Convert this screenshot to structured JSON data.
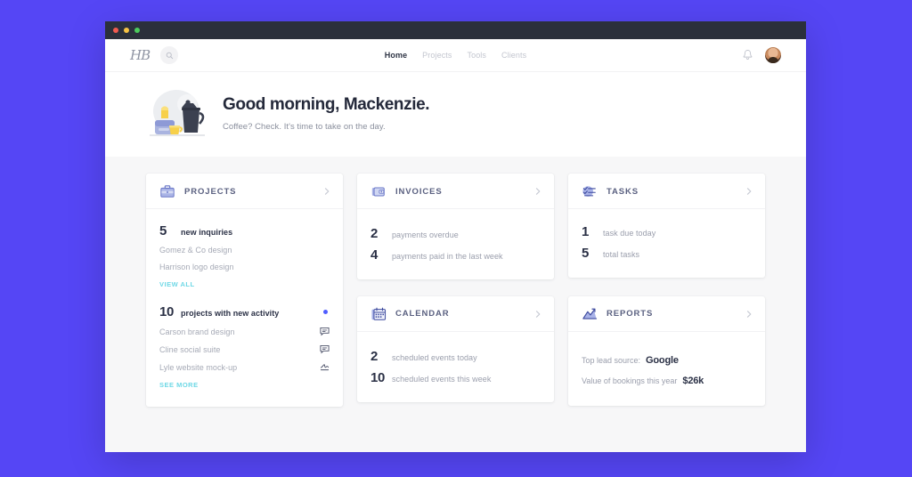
{
  "theme": {
    "page_background": "#5546F5",
    "accent": "#4f5dff",
    "link": "#6fd8e6",
    "titlebar": "#2b303b"
  },
  "window": {
    "traffic_lights": [
      "close-red",
      "minimize-yellow",
      "maximize-green"
    ]
  },
  "nav": {
    "logo_text": "HB",
    "search_icon": "search-icon",
    "links": [
      {
        "label": "Home",
        "active": true
      },
      {
        "label": "Projects",
        "active": false
      },
      {
        "label": "Tools",
        "active": false
      },
      {
        "label": "Clients",
        "active": false
      }
    ],
    "notification_icon": "bell-icon",
    "avatar": "user-avatar"
  },
  "hero": {
    "illustration": "coffee-breakfast-illustration",
    "title": "Good morning, Mackenzie.",
    "subtitle": "Coffee? Check. It's time to take on the day."
  },
  "cards": {
    "projects": {
      "icon": "briefcase-icon",
      "title": "PROJECTS",
      "chevron": "chevron-right-icon",
      "sections": [
        {
          "count": "5",
          "label": "new inquiries",
          "has_dot": false,
          "items": [
            {
              "name": "Gomez & Co design",
              "icon": null
            },
            {
              "name": "Harrison logo design",
              "icon": null
            }
          ],
          "link": "VIEW ALL"
        },
        {
          "count": "10",
          "label": "projects with new activity",
          "has_dot": true,
          "items": [
            {
              "name": "Carson brand design",
              "icon": "comment-icon"
            },
            {
              "name": "Cline social suite",
              "icon": "comment-icon"
            },
            {
              "name": "Lyle website mock-up",
              "icon": "signature-icon"
            }
          ],
          "link": "SEE MORE"
        }
      ]
    },
    "invoices": {
      "icon": "wallet-icon",
      "title": "INVOICES",
      "chevron": "chevron-right-icon",
      "stats": [
        {
          "num": "2",
          "label": "payments overdue"
        },
        {
          "num": "4",
          "label": "payments paid in the last week"
        }
      ]
    },
    "tasks": {
      "icon": "checklist-icon",
      "title": "TASKS",
      "chevron": "chevron-right-icon",
      "stats": [
        {
          "num": "1",
          "label": "task due today"
        },
        {
          "num": "5",
          "label": "total tasks"
        }
      ]
    },
    "calendar": {
      "icon": "calendar-icon",
      "title": "CALENDAR",
      "chevron": "chevron-right-icon",
      "stats": [
        {
          "num": "2",
          "label": "scheduled events today"
        },
        {
          "num": "10",
          "label": "scheduled events this week"
        }
      ]
    },
    "reports": {
      "icon": "chart-mountain-icon",
      "title": "REPORTS",
      "chevron": "chevron-right-icon",
      "rows": [
        {
          "key": "Top lead source:",
          "value": "Google"
        },
        {
          "key": "Value of bookings this year",
          "value": "$26k"
        }
      ]
    }
  }
}
